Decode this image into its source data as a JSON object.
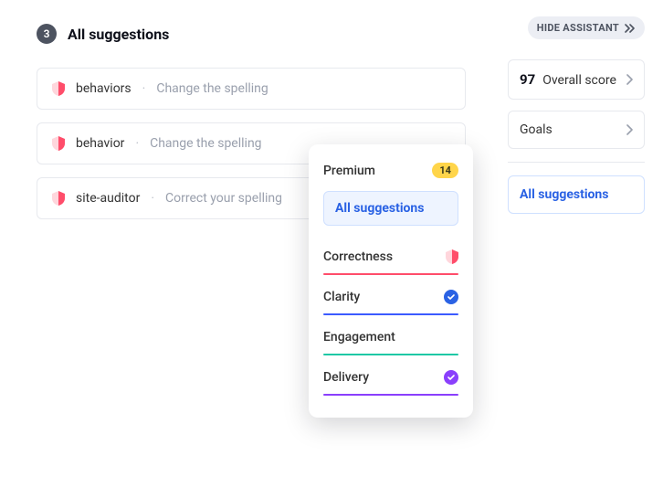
{
  "header": {
    "count": "3",
    "title": "All suggestions"
  },
  "suggestions": [
    {
      "word": "behaviors",
      "hint": "Change the spelling"
    },
    {
      "word": "behavior",
      "hint": "Change the spelling"
    },
    {
      "word": "site-auditor",
      "hint": "Correct your spelling"
    }
  ],
  "popup": {
    "premium_label": "Premium",
    "premium_count": "14",
    "all_btn": "All suggestions",
    "categories": {
      "correctness": "Correctness",
      "clarity": "Clarity",
      "engagement": "Engagement",
      "delivery": "Delivery"
    }
  },
  "sidebar": {
    "hide_label": "HIDE ASSISTANT",
    "score_value": "97",
    "score_label": "Overall score",
    "goals_label": "Goals",
    "all_label": "All suggestions"
  },
  "icons": {
    "shield": "shield-icon",
    "check": "check-icon",
    "chevron_right": "chevron-right-icon",
    "double_chevron": "double-chevron-right-icon"
  }
}
